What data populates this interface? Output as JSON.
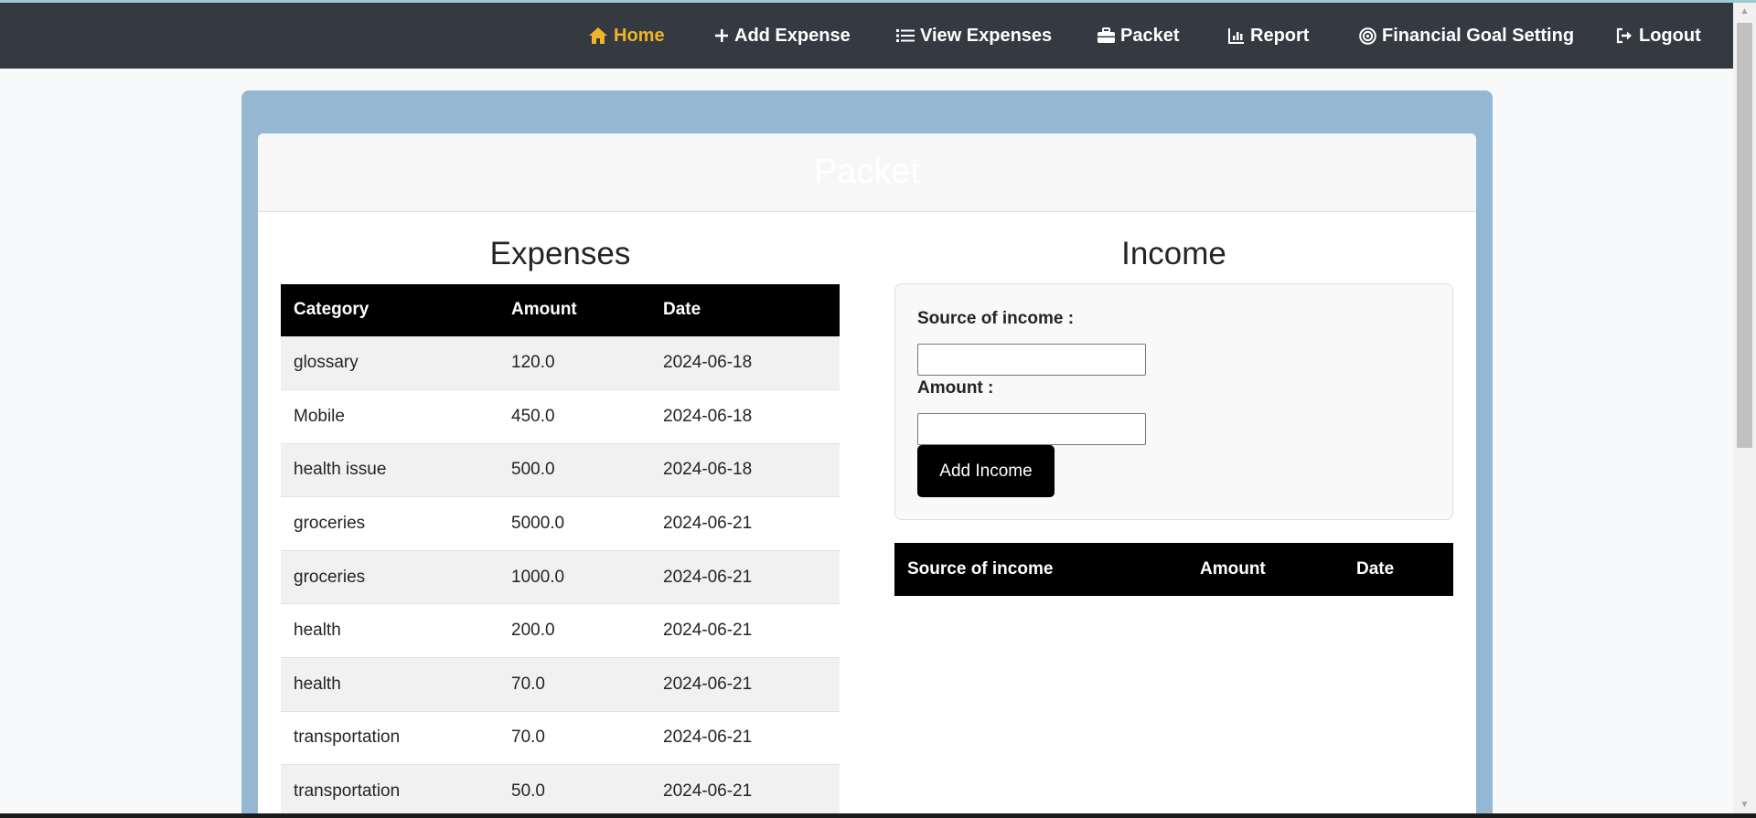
{
  "nav": {
    "items": [
      {
        "label": "Home",
        "icon": "home-icon",
        "active": true
      },
      {
        "label": "Add Expense",
        "icon": "plus-icon",
        "active": false
      },
      {
        "label": "View Expenses",
        "icon": "list-icon",
        "active": false
      },
      {
        "label": "Packet",
        "icon": "briefcase-icon",
        "active": false
      },
      {
        "label": "Report",
        "icon": "chart-icon",
        "active": false
      },
      {
        "label": "Financial Goal Setting",
        "icon": "target-icon",
        "active": false
      },
      {
        "label": "Logout",
        "icon": "logout-icon",
        "active": false
      }
    ],
    "active_color": "#f0b429",
    "background": "#343a40"
  },
  "page": {
    "title": "Packet"
  },
  "expenses": {
    "title": "Expenses",
    "headers": [
      "Category",
      "Amount",
      "Date"
    ],
    "rows": [
      [
        "glossary",
        "120.0",
        "2024-06-18"
      ],
      [
        "Mobile",
        "450.0",
        "2024-06-18"
      ],
      [
        "health issue",
        "500.0",
        "2024-06-18"
      ],
      [
        "groceries",
        "5000.0",
        "2024-06-21"
      ],
      [
        "groceries",
        "1000.0",
        "2024-06-21"
      ],
      [
        "health",
        "200.0",
        "2024-06-21"
      ],
      [
        "health",
        "70.0",
        "2024-06-21"
      ],
      [
        "transportation",
        "70.0",
        "2024-06-21"
      ],
      [
        "transportation",
        "50.0",
        "2024-06-21"
      ]
    ]
  },
  "income": {
    "title": "Income",
    "form": {
      "source_label": "Source of income :",
      "source_value": "",
      "amount_label": "Amount :",
      "amount_value": "",
      "submit_label": "Add Income"
    },
    "headers": [
      "Source of income",
      "Amount",
      "Date"
    ],
    "rows": []
  }
}
